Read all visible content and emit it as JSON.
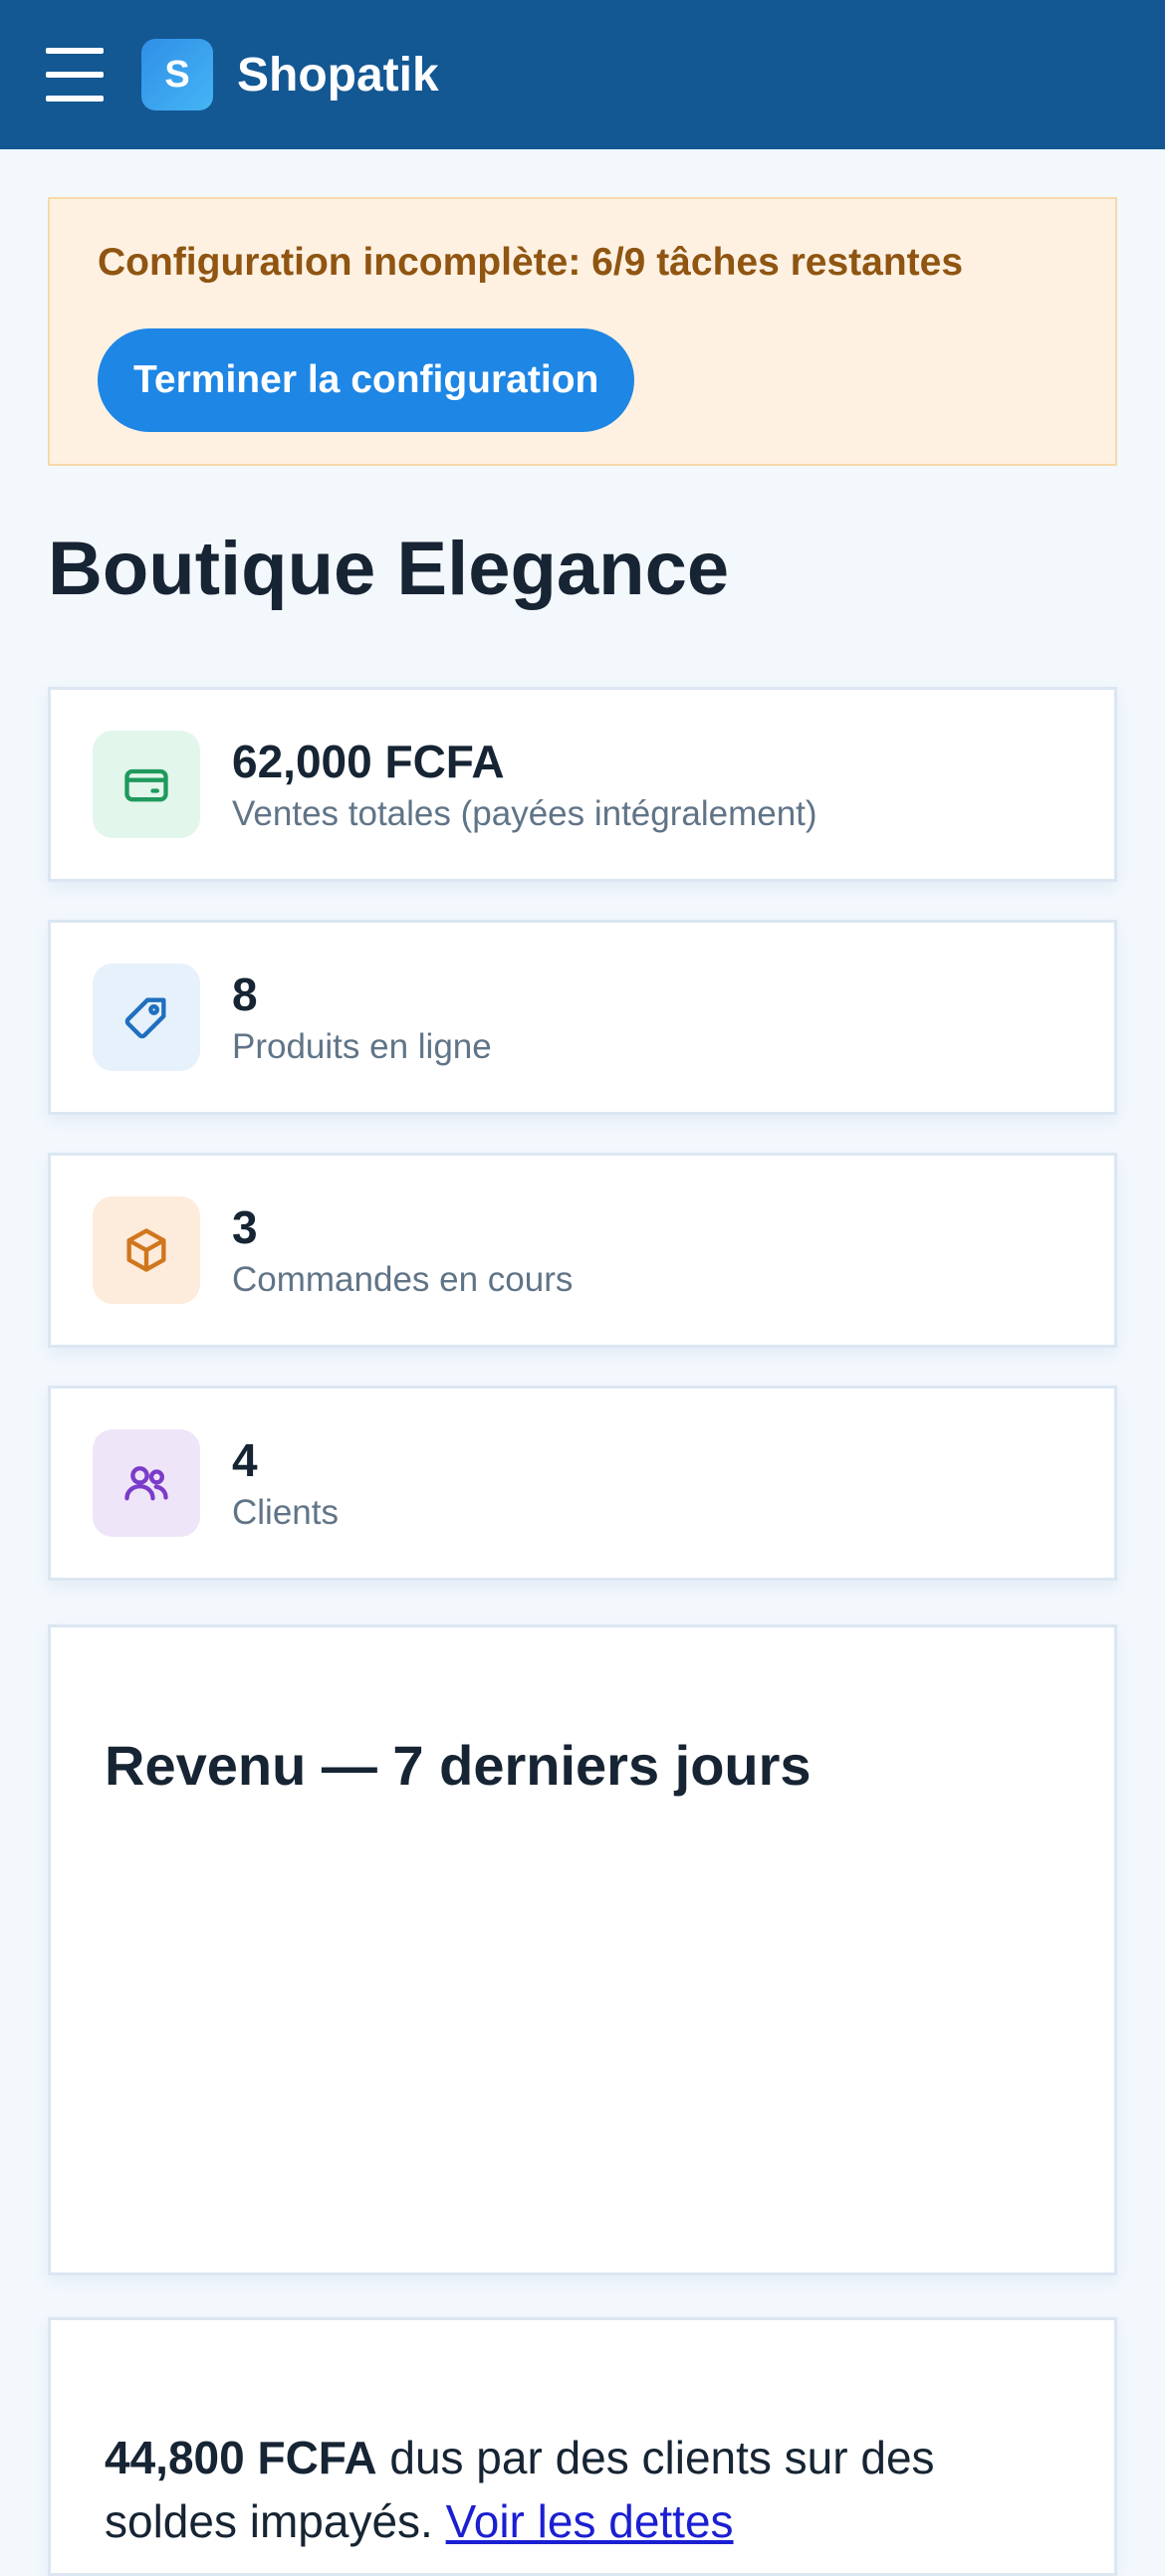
{
  "header": {
    "brand_letter": "S",
    "brand_name": "Shopatik"
  },
  "setup_banner": {
    "message": "Configuration incomplète: 6/9 tâches restantes",
    "button_label": "Terminer la configuration"
  },
  "store": {
    "name": "Boutique Elegance"
  },
  "stats": [
    {
      "value": "62,000 FCFA",
      "label": "Ventes totales (payées intégralement)",
      "icon": "credit-card-icon",
      "bg": "#e3f6ec",
      "color": "#1f9a5c"
    },
    {
      "value": "8",
      "label": "Produits en ligne",
      "icon": "tag-icon",
      "bg": "#e6f1fb",
      "color": "#1f6fbf"
    },
    {
      "value": "3",
      "label": "Commandes en cours",
      "icon": "box-icon",
      "bg": "#fdebdc",
      "color": "#d0761c"
    },
    {
      "value": "4",
      "label": "Clients",
      "icon": "users-icon",
      "bg": "#efe5f8",
      "color": "#7a3bc9"
    }
  ],
  "revenue_panel": {
    "title": "Revenu — 7 derniers jours"
  },
  "debt_panel": {
    "amount": "44,800 FCFA",
    "text": " dus par des clients sur des soldes impayés. ",
    "link": "Voir les dettes"
  },
  "colors": {
    "topbar": "#135793",
    "accent": "#1e86e4",
    "banner_bg": "#fef1e2",
    "banner_text": "#8f5511"
  }
}
